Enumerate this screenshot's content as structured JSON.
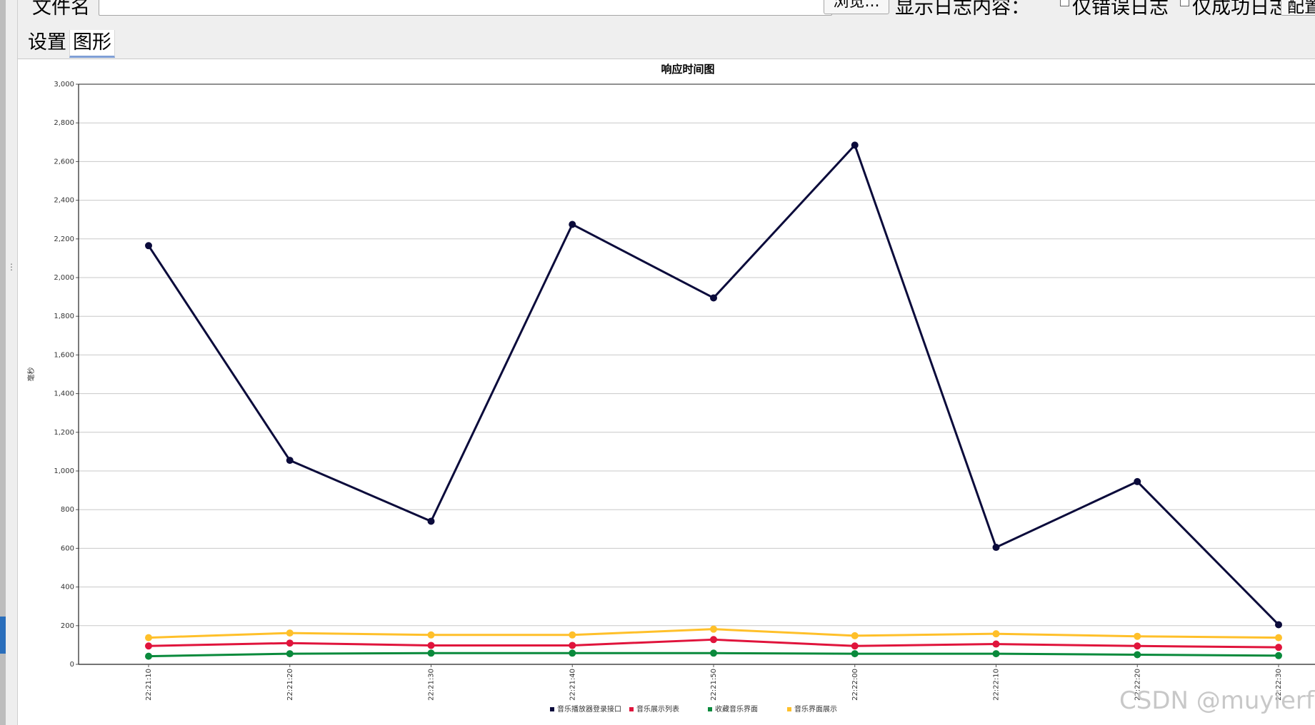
{
  "toolbar": {
    "filename_label": "文件名",
    "filename_value": "",
    "browse_label": "浏览...",
    "show_log_label": "显示日志内容：",
    "errors_only_label": "仅错误日志",
    "success_only_label": "仅成功日志",
    "config_label": "配置"
  },
  "tabs": [
    {
      "label": "设置"
    },
    {
      "label": "图形"
    }
  ],
  "watermark": "CSDN @muyierfly",
  "colors": {
    "series_login": "#0b0b3b",
    "series_list": "#e0143c",
    "series_collect": "#0a8a3c",
    "series_display": "#ffc02a"
  },
  "chart_data": {
    "type": "line",
    "title": "响应时间图",
    "xlabel": "",
    "ylabel": "毫秒",
    "ylim": [
      0,
      3000
    ],
    "yticks": [
      "0",
      "200",
      "400",
      "600",
      "800",
      "1,000",
      "1,200",
      "1,400",
      "1,600",
      "1,800",
      "2,000",
      "2,200",
      "2,400",
      "2,600",
      "2,800",
      "3,000"
    ],
    "categories": [
      "22:21:10",
      "22:21:20",
      "22:21:30",
      "22:21:40",
      "22:21:50",
      "22:22:00",
      "22:22:10",
      "22:22:20",
      "22:22:30"
    ],
    "grid": true,
    "legend_position": "bottom",
    "series": [
      {
        "name": "音乐播放器登录接口",
        "color": "#0b0b3b",
        "values": [
          2165,
          1055,
          740,
          2275,
          1895,
          2685,
          605,
          945,
          205
        ]
      },
      {
        "name": "音乐展示列表",
        "color": "#e0143c",
        "values": [
          95,
          110,
          98,
          98,
          128,
          95,
          105,
          95,
          88
        ]
      },
      {
        "name": "收藏音乐界面",
        "color": "#0a8a3c",
        "values": [
          42,
          55,
          58,
          58,
          58,
          55,
          55,
          50,
          45
        ]
      },
      {
        "name": "音乐界面展示",
        "color": "#ffc02a",
        "values": [
          138,
          162,
          152,
          152,
          182,
          148,
          158,
          145,
          138
        ]
      }
    ]
  }
}
